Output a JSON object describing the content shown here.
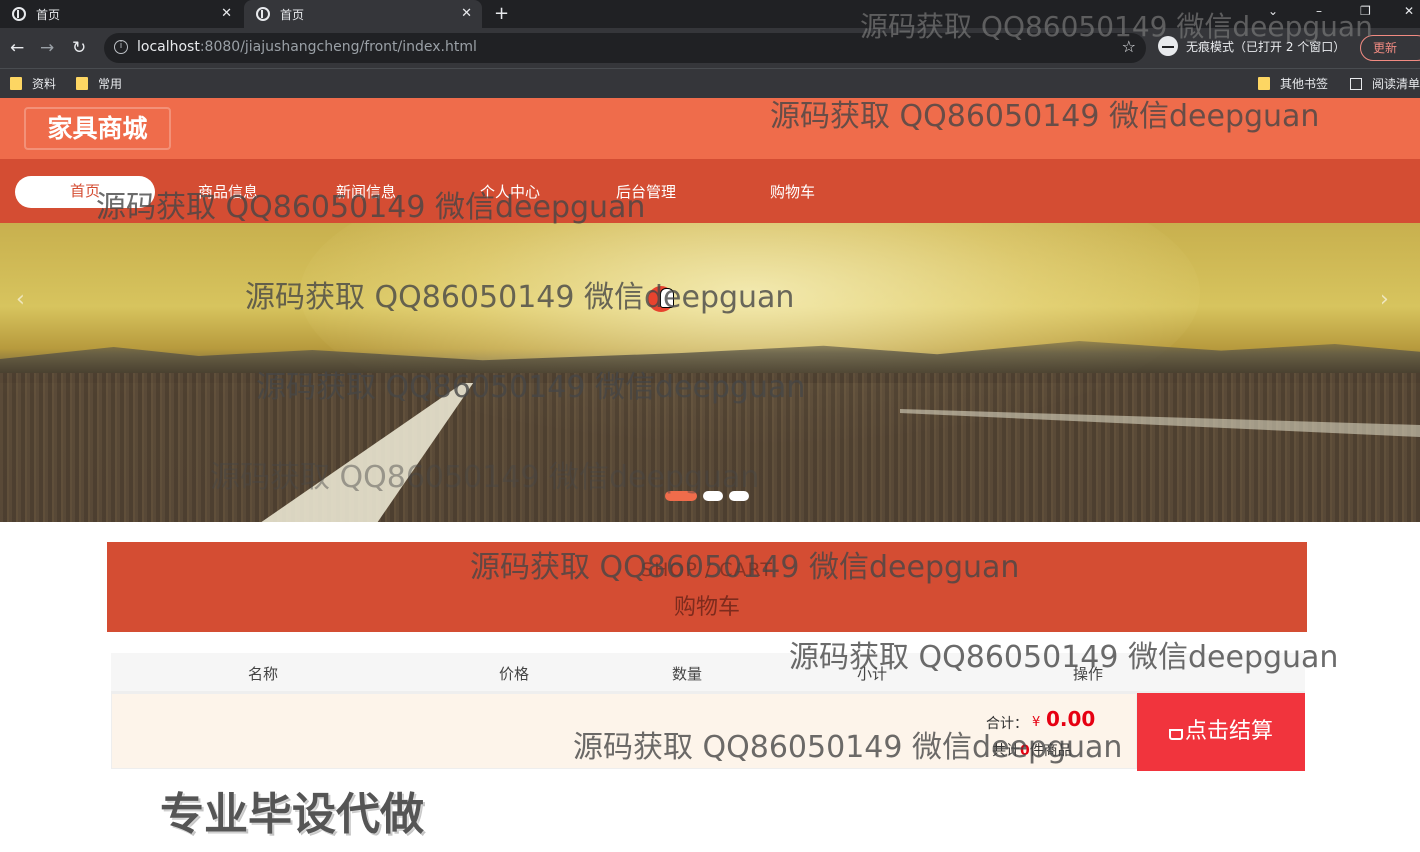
{
  "browser": {
    "tabs": [
      {
        "title": "首页",
        "active": false
      },
      {
        "title": "首页",
        "active": true
      }
    ],
    "url_host": "localhost",
    "url_rest": ":8080/jiajushangcheng/front/index.html",
    "incognito_label": "无痕模式（已打开 2 个窗口）",
    "update_label": "更新",
    "bookmarks": [
      "资料",
      "常用"
    ],
    "other_bookmarks": "其他书签",
    "reading_list": "阅读清单"
  },
  "header": {
    "logo": "家具商城"
  },
  "nav": {
    "items": [
      "首页",
      "商品信息",
      "新闻信息",
      "个人中心",
      "后台管理",
      "购物车"
    ],
    "active_index": 0
  },
  "banner": {
    "slide_count": 3,
    "active_slide": 0
  },
  "cart": {
    "title_en": "SHOP / CART",
    "title_cn": "购物车",
    "columns": [
      "名称",
      "价格",
      "数量",
      "小计",
      "操作"
    ],
    "total_label": "合计：",
    "currency": "¥",
    "total": "0.00",
    "count_prefix": "共计",
    "count": "0",
    "count_suffix": "件商品",
    "checkout_label": "点击结算"
  },
  "overlay": {
    "watermark": "源码获取 QQ86050149 微信deepguan",
    "ad": "专业毕设代做"
  },
  "colors": {
    "header": "#ef6c4b",
    "navbar": "#d44d33",
    "checkout": "#f1343d",
    "price": "#e60012"
  }
}
